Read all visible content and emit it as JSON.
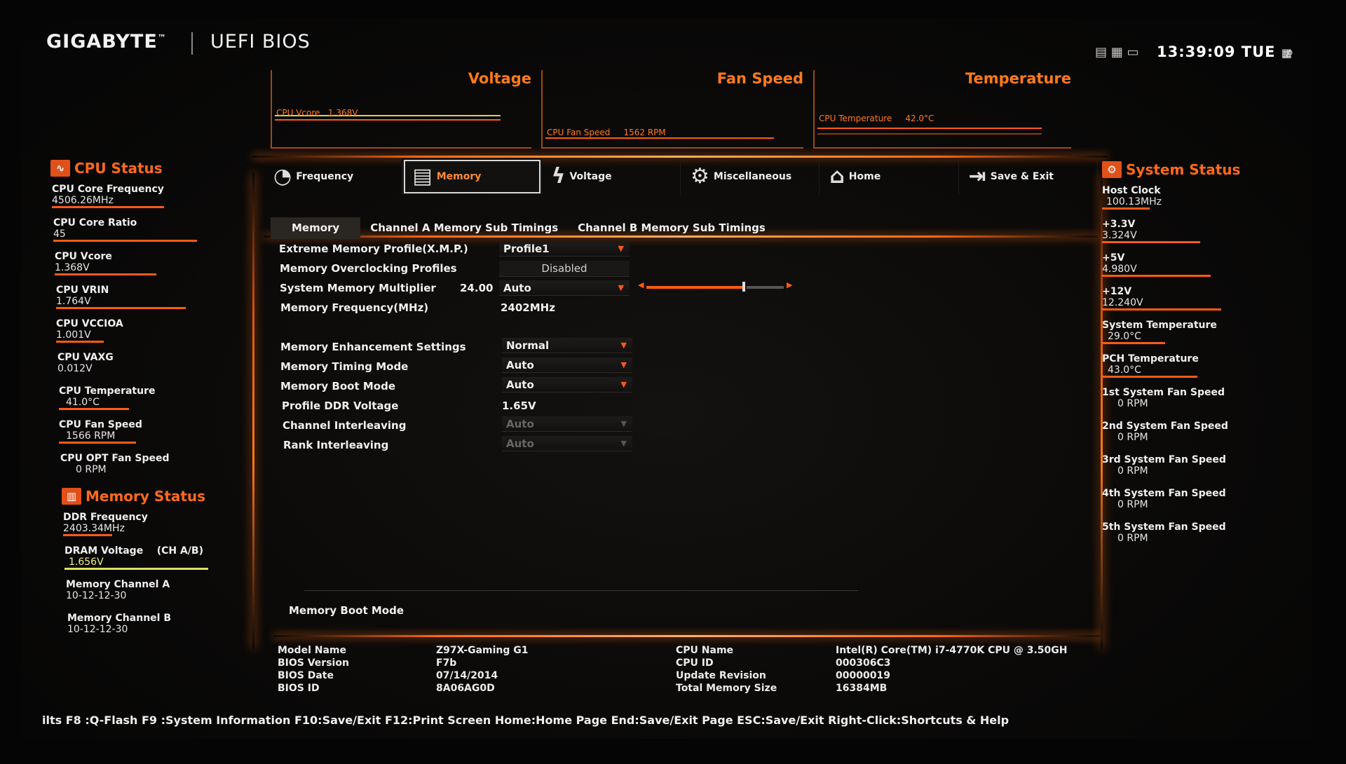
{
  "header": {
    "brand": "GIGABYTE",
    "trademark": "™",
    "product": "UEFI BIOS",
    "clock": "13:39:09 TUE",
    "view_icons": [
      "layout-icon",
      "grid-icon",
      "window-icon"
    ]
  },
  "monitors": [
    {
      "title": "Voltage",
      "label": "CPU Vcore",
      "value": "1.368V"
    },
    {
      "title": "Fan Speed",
      "label": "CPU Fan Speed",
      "value": "1562 RPM"
    },
    {
      "title": "Temperature",
      "label": "CPU Temperature",
      "value": "42.0°C"
    }
  ],
  "cpu_status": {
    "title": "CPU Status",
    "items": [
      {
        "label": "CPU Core Frequency",
        "value": "4506.26MHz"
      },
      {
        "label": "CPU Core Ratio",
        "value": "45"
      },
      {
        "label": "CPU Vcore",
        "value": "1.368V"
      },
      {
        "label": "CPU VRIN",
        "value": "1.764V"
      },
      {
        "label": "CPU VCCIOA",
        "value": "1.001V"
      },
      {
        "label": "CPU VAXG",
        "value": "0.012V"
      },
      {
        "label": "CPU Temperature",
        "value": "41.0°C"
      },
      {
        "label": "CPU Fan Speed",
        "value": "1566 RPM"
      },
      {
        "label": "CPU OPT Fan Speed",
        "value": "0 RPM"
      }
    ]
  },
  "memory_status": {
    "title": "Memory Status",
    "items": [
      {
        "label": "DDR Frequency",
        "value": "2403.34MHz"
      },
      {
        "label": "DRAM Voltage",
        "extra": "(CH A/B)",
        "value": "1.656V"
      },
      {
        "label": "Memory Channel A",
        "value": "10-12-12-30"
      },
      {
        "label": "Memory Channel B",
        "value": "10-12-12-30"
      }
    ]
  },
  "system_status": {
    "title": "System Status",
    "items": [
      {
        "label": "Host Clock",
        "value": "100.13MHz"
      },
      {
        "label": "+3.3V",
        "value": "3.324V"
      },
      {
        "label": "+5V",
        "value": "4.980V"
      },
      {
        "label": "+12V",
        "value": "12.240V"
      },
      {
        "label": "System Temperature",
        "value": "29.0°C"
      },
      {
        "label": "PCH Temperature",
        "value": "43.0°C"
      },
      {
        "label": "1st System Fan Speed",
        "value": "0 RPM"
      },
      {
        "label": "2nd System Fan Speed",
        "value": "0 RPM"
      },
      {
        "label": "3rd System Fan Speed",
        "value": "0 RPM"
      },
      {
        "label": "4th System Fan Speed",
        "value": "0 RPM"
      },
      {
        "label": "5th System Fan Speed",
        "value": "0 RPM"
      }
    ]
  },
  "tabs": [
    {
      "label": "Frequency",
      "icon": "frequency-icon"
    },
    {
      "label": "Memory",
      "icon": "memory-icon",
      "active": true
    },
    {
      "label": "Voltage",
      "icon": "voltage-icon"
    },
    {
      "label": "Miscellaneous",
      "icon": "gear-icon"
    },
    {
      "label": "Home",
      "icon": "home-icon"
    },
    {
      "label": "Save & Exit",
      "icon": "exit-icon"
    }
  ],
  "subtabs": [
    {
      "label": "Memory",
      "active": true
    },
    {
      "label": "Channel A Memory Sub Timings"
    },
    {
      "label": "Channel B Memory Sub Timings"
    }
  ],
  "settings": {
    "xmp": {
      "label": "Extreme Memory Profile(X.M.P.)",
      "value": "Profile1"
    },
    "moc": {
      "label": "Memory Overclocking Profiles",
      "value": "Disabled"
    },
    "multiplier": {
      "label": "System Memory Multiplier",
      "current": "24.00",
      "value": "Auto",
      "slider_fraction": 0.7
    },
    "frequency": {
      "label": "Memory Frequency(MHz)",
      "value": "2402MHz"
    },
    "enhancement": {
      "label": "Memory Enhancement Settings",
      "value": "Normal"
    },
    "timing_mode": {
      "label": "Memory Timing Mode",
      "value": "Auto"
    },
    "boot_mode": {
      "label": "Memory Boot Mode",
      "value": "Auto"
    },
    "ddr_voltage": {
      "label": "Profile DDR Voltage",
      "value": "1.65V"
    },
    "channel_interleaving": {
      "label": "Channel Interleaving",
      "value": "Auto"
    },
    "rank_interleaving": {
      "label": "Rank Interleaving",
      "value": "Auto"
    }
  },
  "help_text": "Memory Boot Mode",
  "system_info": {
    "left": [
      {
        "label": "Model Name",
        "value": "Z97X-Gaming G1"
      },
      {
        "label": "BIOS Version",
        "value": "F7b"
      },
      {
        "label": "BIOS Date",
        "value": "07/14/2014"
      },
      {
        "label": "BIOS ID",
        "value": "8A06AG0D"
      }
    ],
    "right": [
      {
        "label": "CPU Name",
        "value": "Intel(R) Core(TM) i7-4770K CPU @ 3.50GH"
      },
      {
        "label": "CPU ID",
        "value": "000306C3"
      },
      {
        "label": "Update Revision",
        "value": "00000019"
      },
      {
        "label": "Total Memory Size",
        "value": "16384MB"
      }
    ]
  },
  "footer": "ilts F8 :Q-Flash F9 :System Information F10:Save/Exit F12:Print Screen Home:Home Page End:Save/Exit Page ESC:Save/Exit Right-Click:Shortcuts & Help",
  "colors": {
    "accent": "#ff6a14",
    "background": "#0a0908",
    "text": "#f0f0f0"
  }
}
